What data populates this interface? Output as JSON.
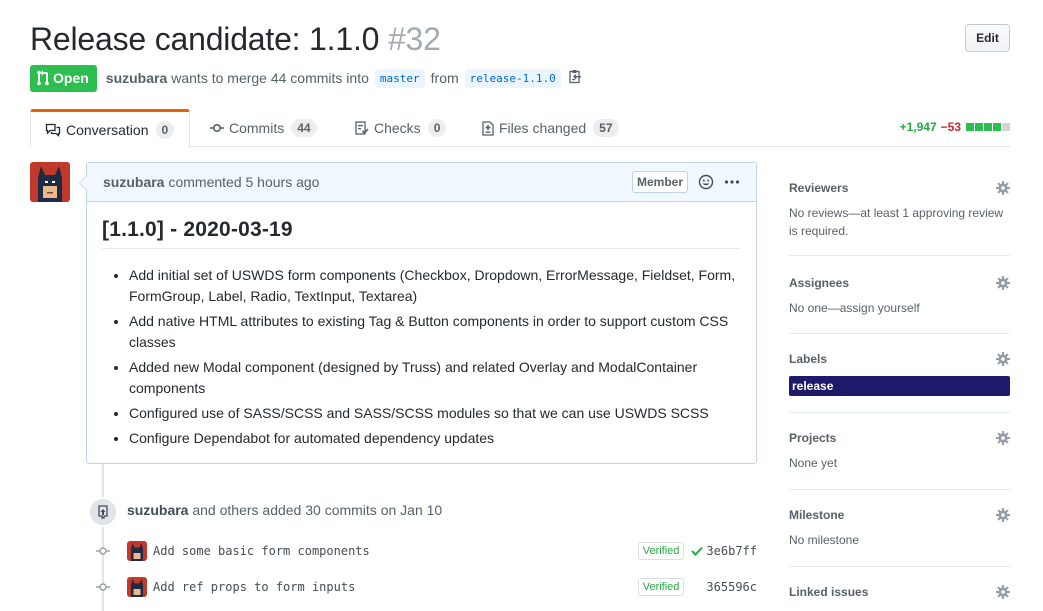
{
  "pr": {
    "title": "Release candidate: 1.1.0",
    "number": "#32",
    "edit_label": "Edit",
    "state": "Open",
    "author": "suzubara",
    "merge_text": "wants to merge 44 commits into",
    "base_branch": "master",
    "from_text": "from",
    "head_branch": "release-1.1.0"
  },
  "tabs": [
    {
      "label": "Conversation",
      "count": "0"
    },
    {
      "label": "Commits",
      "count": "44"
    },
    {
      "label": "Checks",
      "count": "0"
    },
    {
      "label": "Files changed",
      "count": "57"
    }
  ],
  "diffstat": {
    "additions": "+1,947",
    "deletions": "−53"
  },
  "comment": {
    "author": "suzubara",
    "action": "commented 5 hours ago",
    "badge": "Member",
    "heading": "[1.1.0] - 2020-03-19",
    "items": [
      "Add initial set of USWDS form components (Checkbox, Dropdown, ErrorMessage, Fieldset, Form, FormGroup, Label, Radio, TextInput, Textarea)",
      "Add native HTML attributes to existing Tag & Button components in order to support custom CSS classes",
      "Added new Modal component (designed by Truss) and related Overlay and ModalContainer components",
      "Configured use of SASS/SCSS and SASS/SCSS modules so that we can use USWDS SCSS",
      "Configure Dependabot for automated dependency updates"
    ]
  },
  "commits_summary": {
    "author": "suzubara",
    "text": "and others added 30 commits",
    "date": "on Jan 10"
  },
  "commits": [
    {
      "message": "Add some basic form components",
      "verified": "Verified",
      "sha": "3e6b7ff",
      "check": true
    },
    {
      "message": "Add ref props to form inputs",
      "verified": "Verified",
      "sha": "365596c",
      "check": false
    }
  ],
  "sidebar": {
    "reviewers": {
      "title": "Reviewers",
      "body": "No reviews—at least 1 approving review is required."
    },
    "assignees": {
      "title": "Assignees",
      "body": "No one—assign yourself"
    },
    "labels": {
      "title": "Labels",
      "label": "release",
      "label_color": "#1d1a6a"
    },
    "projects": {
      "title": "Projects",
      "body": "None yet"
    },
    "milestone": {
      "title": "Milestone",
      "body": "No milestone"
    },
    "linked_issues": {
      "title": "Linked issues"
    }
  },
  "colors": {
    "open": "#2cbe4e",
    "additions": "#28a745",
    "deletions": "#cb2431",
    "link": "#0366d6"
  }
}
